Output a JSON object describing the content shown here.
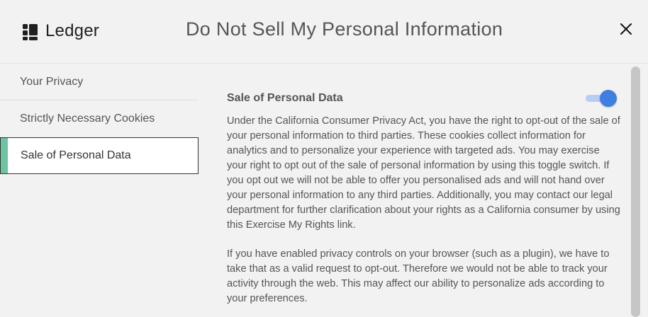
{
  "header": {
    "logo_text": "Ledger",
    "title": "Do Not Sell My Personal Information",
    "close_icon": "close-icon"
  },
  "sidebar": {
    "items": [
      {
        "label": "Your Privacy",
        "active": false
      },
      {
        "label": "Strictly Necessary Cookies",
        "active": false
      },
      {
        "label": "Sale of Personal Data",
        "active": true
      }
    ],
    "accent_color": "#6cc4a1"
  },
  "main": {
    "section_title": "Sale of Personal Data",
    "toggle": {
      "state": "on",
      "color": "#3f7fe0"
    },
    "paragraphs": [
      "Under the California Consumer Privacy Act, you have the right to opt-out of the sale of your personal information to third parties. These cookies collect information for analytics and to personalize your experience with targeted ads. You may exercise your right to opt out of the sale of personal information by using this toggle switch. If you opt out we will not be able to offer you personalised ads and will not hand over your personal information to any third parties. Additionally, you may contact our legal department for further clarification about your rights as a California consumer by using this Exercise My Rights link.",
      "If you have enabled privacy controls on your browser (such as a plugin), we have to take that as a valid request to opt-out. Therefore we would not be able to track your activity through the web. This may affect our ability to personalize ads according to your preferences."
    ]
  }
}
